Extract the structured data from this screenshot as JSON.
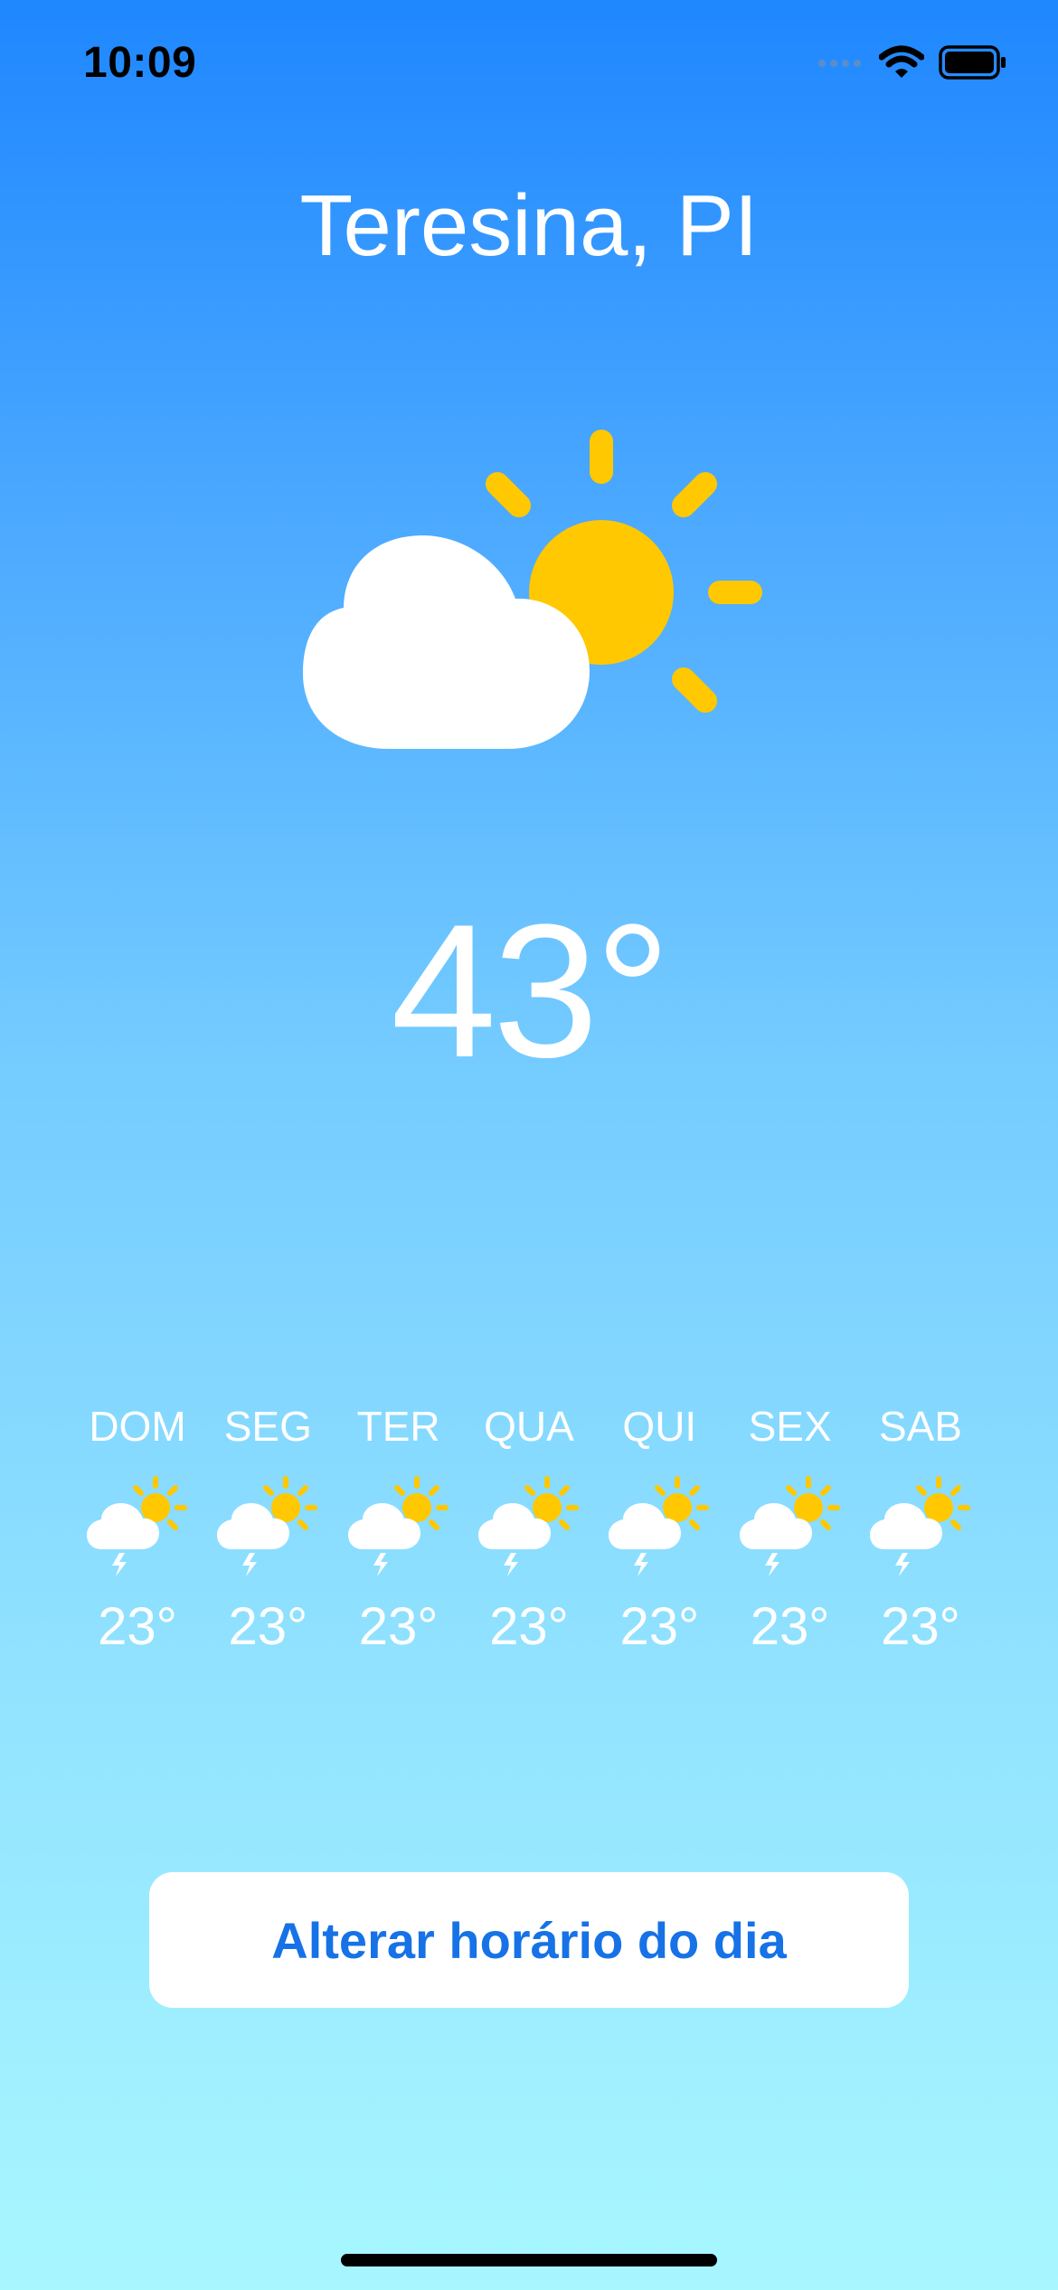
{
  "status_bar": {
    "time": "10:09",
    "icons": [
      "cellular-signal-icon",
      "wifi-icon",
      "battery-icon"
    ]
  },
  "location": {
    "city": "Teresina, PI"
  },
  "current": {
    "icon": "partly-cloudy-icon",
    "temperature": "43°"
  },
  "forecast": [
    {
      "day": "DOM",
      "icon": "thunderstorm-partly-sunny-icon",
      "temp": "23°"
    },
    {
      "day": "SEG",
      "icon": "thunderstorm-partly-sunny-icon",
      "temp": "23°"
    },
    {
      "day": "TER",
      "icon": "thunderstorm-partly-sunny-icon",
      "temp": "23°"
    },
    {
      "day": "QUA",
      "icon": "thunderstorm-partly-sunny-icon",
      "temp": "23°"
    },
    {
      "day": "QUI",
      "icon": "thunderstorm-partly-sunny-icon",
      "temp": "23°"
    },
    {
      "day": "SEX",
      "icon": "thunderstorm-partly-sunny-icon",
      "temp": "23°"
    },
    {
      "day": "SAB",
      "icon": "thunderstorm-partly-sunny-icon",
      "temp": "23°"
    }
  ],
  "action": {
    "label": "Alterar horário do dia"
  },
  "colors": {
    "gradient_top": "#1f87ff",
    "gradient_bottom": "#a8f7ff",
    "sun": "#ffc800",
    "button_text": "#1672e6"
  }
}
